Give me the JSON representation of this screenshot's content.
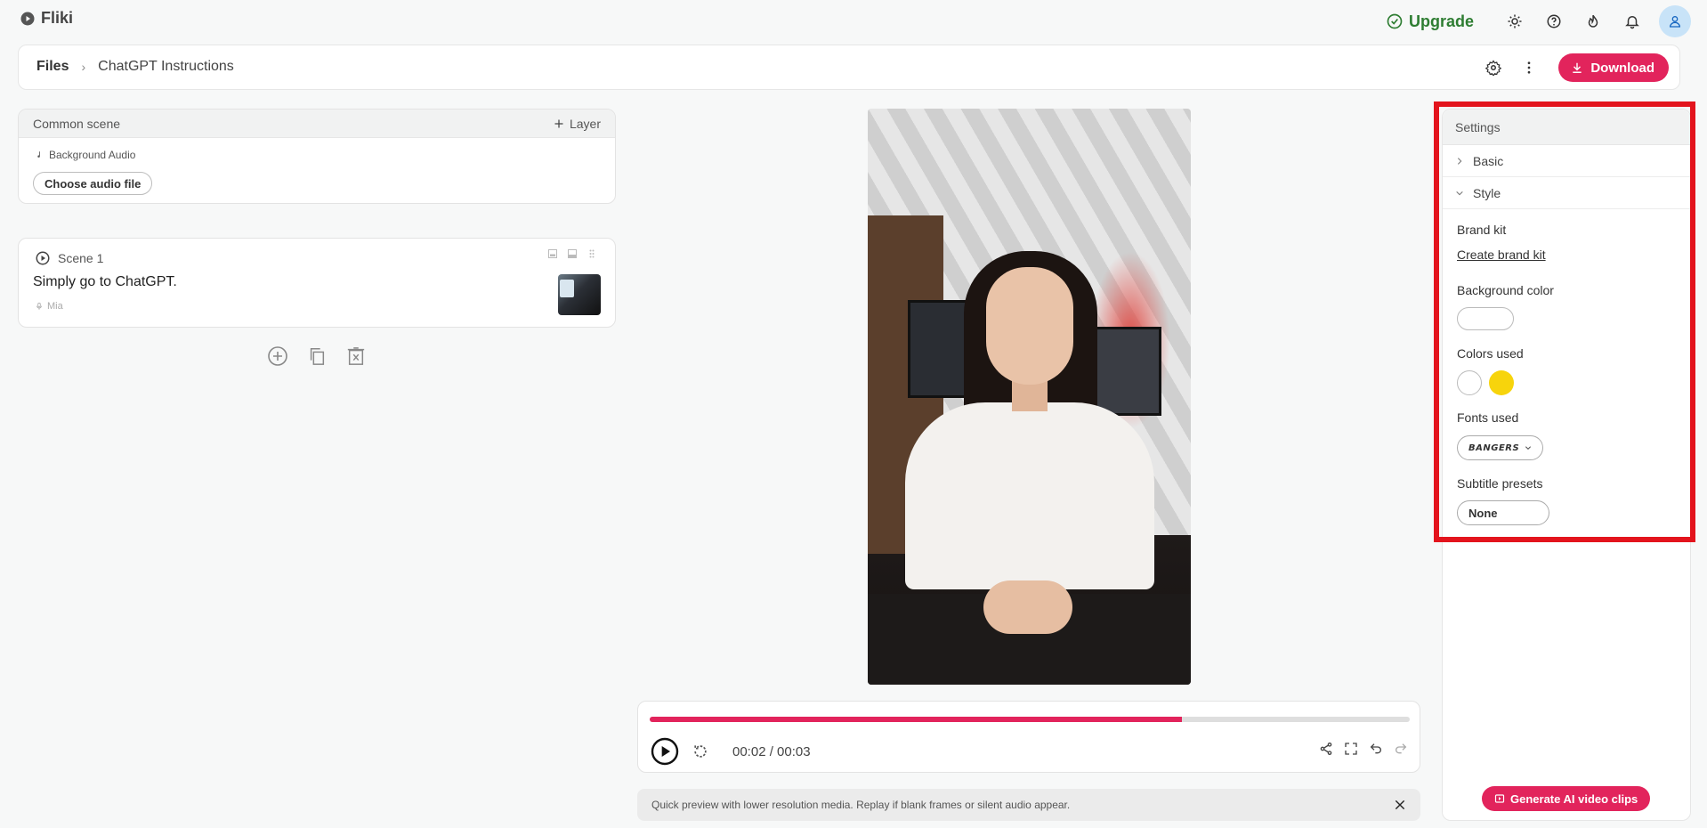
{
  "app": {
    "name": "Fliki"
  },
  "topbar": {
    "upgrade_label": "Upgrade"
  },
  "colors": {
    "accent": "#e2245c",
    "upgrade": "#2e7d32",
    "highlight": "#e3141d",
    "swatch_white": "#ffffff",
    "swatch_yellow": "#f7d40c"
  },
  "header": {
    "breadcrumb_root": "Files",
    "breadcrumb_sep": "›",
    "doc_title": "ChatGPT Instructions",
    "download_label": "Download"
  },
  "common_scene": {
    "title": "Common scene",
    "layer_label": "Layer",
    "audio_label": "Background Audio",
    "choose_audio_label": "Choose audio file"
  },
  "scene": {
    "label": "Scene 1",
    "text": "Simply go to ChatGPT.",
    "voice": "Mia"
  },
  "player": {
    "progress": 0.7,
    "time": "00:02 / 00:03"
  },
  "notice": {
    "text": "Quick preview with lower resolution media. Replay if blank frames or silent audio appear."
  },
  "settings": {
    "title": "Settings",
    "sections": [
      {
        "label": "Basic",
        "expanded": false
      },
      {
        "label": "Style",
        "expanded": true
      }
    ],
    "brand_kit_label": "Brand kit",
    "create_brand_kit": "Create brand kit",
    "background_color_label": "Background color",
    "colors_used_label": "Colors used",
    "fonts_used_label": "Fonts used",
    "font_value": "BANGERS",
    "subtitle_presets_label": "Subtitle presets",
    "subtitle_preset_value": "None",
    "generate_label": "Generate AI video clips"
  }
}
